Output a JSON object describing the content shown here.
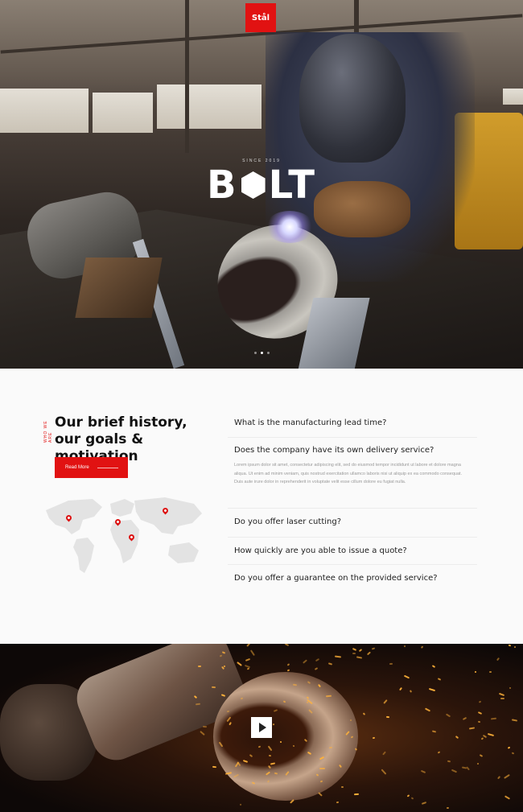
{
  "brand": {
    "logo_text": "Stål",
    "accent_color": "#e11212"
  },
  "hero": {
    "kicker": "SINCE 2019",
    "title_left": "B",
    "title_right": "LT",
    "slides_total": 3,
    "slide_active": 2
  },
  "about": {
    "side_label": "WHO WE ARE",
    "title": "Our brief history, our goals & motivation",
    "cta_label": "Read More",
    "map_icon": "world-map-icon"
  },
  "faq": {
    "items": [
      {
        "question": "What is the manufacturing lead time?",
        "answer": ""
      },
      {
        "question": "Does the company have its own delivery service?",
        "answer": "Lorem ipsum dolor sit amet, consectetur adipiscing elit, sed do eiusmod tempor incididunt ut labore et dolore magna aliqua. Ut enim ad minim veniam, quis nostrud exercitation ullamco laboris nisi ut aliquip ex ea commodo consequat. Duis aute irure dolor in reprehenderit in voluptate velit esse cillum dolore eu fugiat nulla."
      },
      {
        "question": "Do you offer laser cutting?",
        "answer": ""
      },
      {
        "question": "How quickly are you able to issue a quote?",
        "answer": ""
      },
      {
        "question": "Do you offer a guarantee on the provided service?",
        "answer": ""
      }
    ]
  },
  "video": {
    "play_icon": "play-icon"
  }
}
